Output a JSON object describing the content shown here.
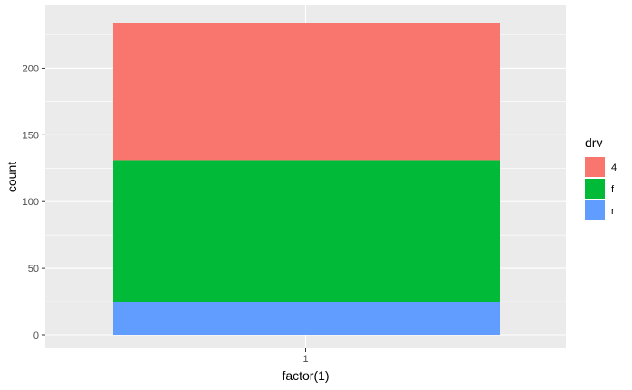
{
  "chart_data": {
    "type": "bar",
    "stacked": true,
    "categories": [
      "1"
    ],
    "series": [
      {
        "name": "4",
        "values": [
          103
        ],
        "color": "#F8766D"
      },
      {
        "name": "f",
        "values": [
          106
        ],
        "color": "#00BA38"
      },
      {
        "name": "r",
        "values": [
          25
        ],
        "color": "#619CFF"
      }
    ],
    "stack_order_bottom_to_top": [
      "r",
      "f",
      "4"
    ],
    "xlabel": "factor(1)",
    "ylabel": "count",
    "ylim": [
      0,
      234
    ],
    "yticks": [
      0,
      50,
      100,
      150,
      200
    ],
    "legend": {
      "title": "drv",
      "position": "right",
      "entries": [
        "4",
        "f",
        "r"
      ]
    },
    "grid": true,
    "panel_background": "#EBEBEB"
  }
}
